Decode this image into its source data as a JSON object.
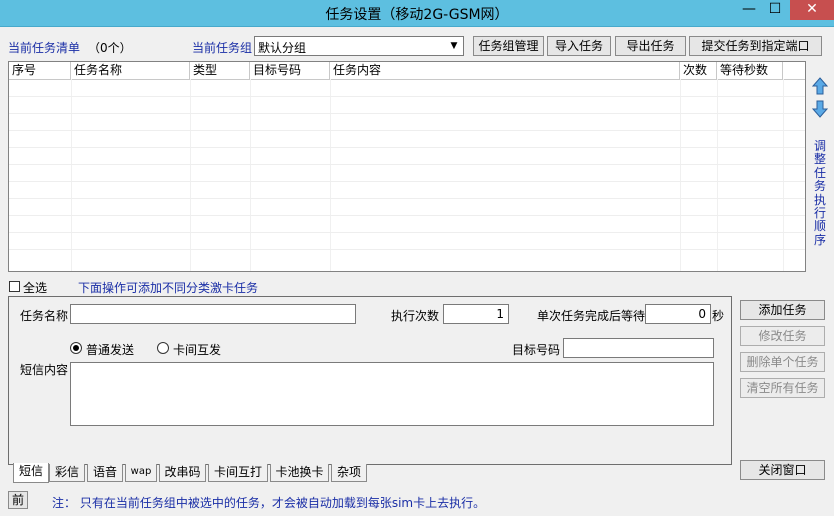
{
  "window": {
    "title": "任务设置（移动2G-GSM网）",
    "min": "—",
    "max": "☐",
    "close": "✕"
  },
  "header": {
    "task_list_label": "当前任务清单",
    "task_count": "（0个）",
    "group_label": "当前任务组",
    "group_value": "默认分组",
    "buttons": {
      "group_manage": "任务组管理",
      "import": "导入任务",
      "export": "导出任务",
      "submit_port": "提交任务到指定端口"
    }
  },
  "table": {
    "columns": [
      "序号",
      "任务名称",
      "类型",
      "目标号码",
      "任务内容",
      "次数",
      "等待秒数"
    ],
    "rows": []
  },
  "reorder": {
    "label": "调整任务执行顺序"
  },
  "select_all": {
    "label": "全选",
    "checked": false
  },
  "hint": "下面操作可添加不同分类激卡任务",
  "form": {
    "task_name_label": "任务名称",
    "task_name_value": "",
    "exec_count_label": "执行次数",
    "exec_count_value": "1",
    "wait_label": "单次任务完成后等待",
    "wait_value": "0",
    "wait_unit": "秒",
    "send_normal": "普通发送",
    "send_inter_card": "卡间互发",
    "target_label": "目标号码",
    "target_value": "",
    "sms_label": "短信内容",
    "sms_value": ""
  },
  "side_buttons": {
    "add": "添加任务",
    "modify": "修改任务",
    "delete_one": "删除单个任务",
    "clear_all": "清空所有任务",
    "close": "关闭窗口"
  },
  "tabs": [
    "短信",
    "彩信",
    "语音",
    "wap",
    "改串码",
    "卡间互打",
    "卡池换卡",
    "杂项"
  ],
  "status": {
    "prev": "前",
    "note": "注：  只有在当前任务组中被选中的任务，才会被自动加载到每张sim卡上去执行。"
  }
}
